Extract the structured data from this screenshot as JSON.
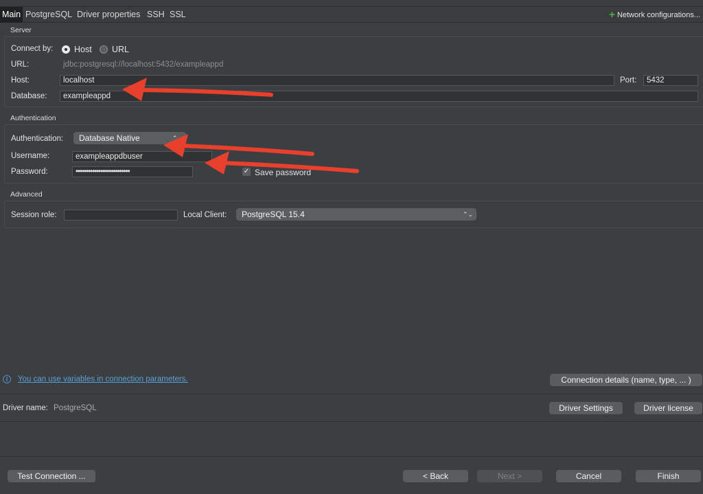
{
  "tabs": [
    {
      "label": "Main"
    },
    {
      "label": "PostgreSQL"
    },
    {
      "label": "Driver properties"
    },
    {
      "label": "SSH"
    },
    {
      "label": "SSL"
    }
  ],
  "network_config": "Network configurations...",
  "server": {
    "title": "Server",
    "connect_by_label": "Connect by:",
    "host_option": "Host",
    "url_option": "URL",
    "url_label": "URL:",
    "url_value": "jdbc:postgresql://localhost:5432/exampleappd",
    "host_label": "Host:",
    "host_value": "localhost",
    "port_label": "Port:",
    "port_value": "5432",
    "database_label": "Database:",
    "database_value": "exampleappd"
  },
  "auth": {
    "title": "Authentication",
    "auth_label": "Authentication:",
    "auth_value": "Database Native",
    "username_label": "Username:",
    "username_value": "exampleappdbuser",
    "password_label": "Password:",
    "password_value": "••••••••••••••••••••••••••",
    "save_password": "Save password"
  },
  "advanced": {
    "title": "Advanced",
    "session_role_label": "Session role:",
    "session_role_value": "",
    "local_client_label": "Local Client:",
    "local_client_value": "PostgreSQL 15.4"
  },
  "info_link": "You can use variables in connection parameters.",
  "connection_details_button": "Connection details (name, type, ... )",
  "driver": {
    "label": "Driver name:",
    "value": "PostgreSQL",
    "settings_button": "Driver Settings",
    "license_button": "Driver license"
  },
  "footer": {
    "test_button": "Test Connection ...",
    "back_button": "< Back",
    "next_button": "Next >",
    "cancel_button": "Cancel",
    "finish_button": "Finish"
  },
  "colors": {
    "annotation_arrow": "#e8402c",
    "link": "#5a9fd8",
    "plus": "#4fae4f"
  }
}
